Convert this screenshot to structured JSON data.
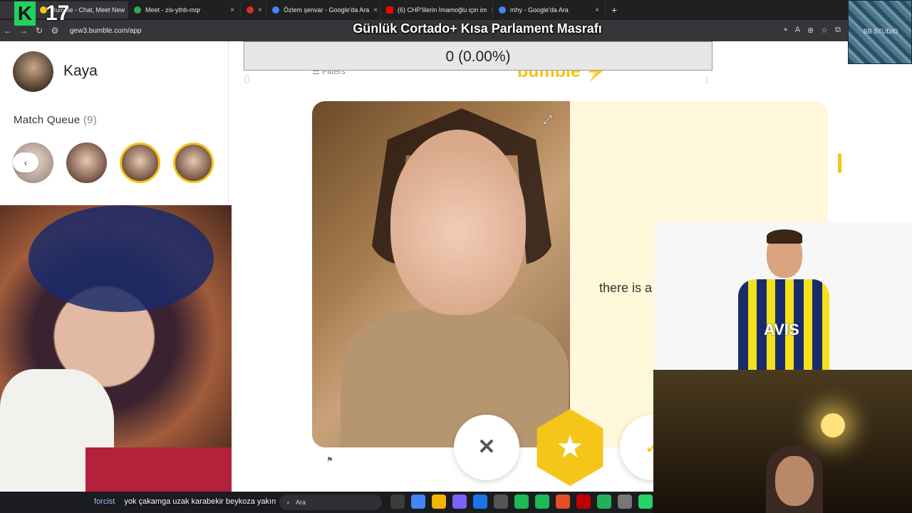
{
  "stream": {
    "viewer_count": "17",
    "title": "Günlük Cortado+ Kısa Parlament Masrafı",
    "stat_bar": "0 (0.00%)",
    "bb_studio_label": "BB STUDIO",
    "chat_user": "forcist",
    "chat_message": "yok çakamga uzak karabekir beykoza yakın"
  },
  "browser": {
    "tabs": [
      {
        "label": "Bumble - Chat, Meet New",
        "color": "#f5c518"
      },
      {
        "label": "Meet - zis-ythb-mqr",
        "color": "#34a853"
      },
      {
        "label": "",
        "color": "#d93025"
      },
      {
        "label": "Özlem şenvar - Google'da Ara",
        "color": "#4285f4"
      },
      {
        "label": "(6) CHP'lilerin İmamoğlu için im",
        "color": "#ff0000"
      },
      {
        "label": "mhy - Google'da Ara",
        "color": "#4285f4"
      }
    ],
    "url": "gew3.bumble.com/app",
    "new_tab": "+",
    "tab_close": "×"
  },
  "sidebar": {
    "profile_name": "Kaya",
    "match_queue_label": "Match Queue",
    "match_queue_count": "(9)"
  },
  "main": {
    "filters_label": "Filters",
    "logo_text": "bumble",
    "left_number": "0",
    "right_number": "1",
    "card_text": "there is a"
  },
  "actions": {
    "pass_icon": "✕",
    "superswipe_icon": "★",
    "like_icon": "✓"
  },
  "cam": {
    "jersey_text": "AVIS"
  },
  "taskbar": {
    "search_placeholder": "Ara",
    "apps": [
      "#3c3c3c",
      "#4285f4",
      "#f4b400",
      "#7b61ff",
      "#1a73e8",
      "#555555",
      "#1db954",
      "#1db954",
      "#e34f26",
      "#c00000",
      "#20b15a",
      "#777777",
      "#25d366"
    ]
  },
  "colors": {
    "brand_yellow": "#f5c518",
    "card_bg": "#fff7d9"
  }
}
